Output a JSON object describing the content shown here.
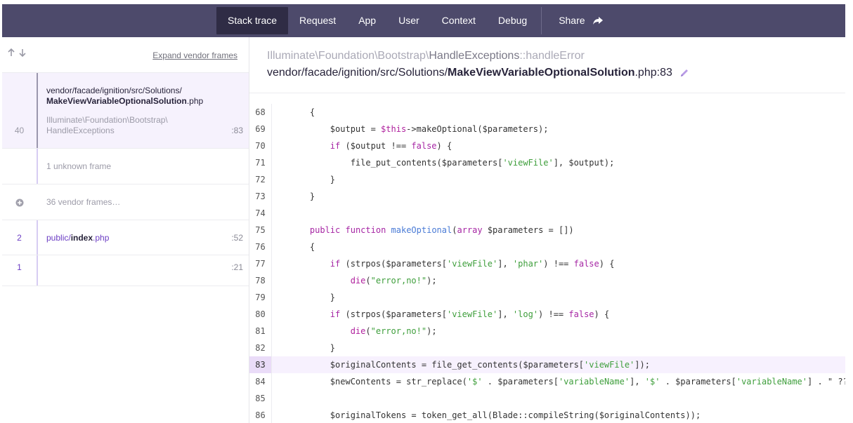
{
  "nav": {
    "tabs": [
      "Stack trace",
      "Request",
      "App",
      "User",
      "Context",
      "Debug"
    ],
    "share": "Share"
  },
  "sidebar": {
    "expand_label": "Expand vendor frames",
    "frames": [
      {
        "number": "40",
        "path_prefix": "vendor/facade/ignition/src/Solutions/",
        "path_bold": "MakeViewVariableOptionalSolution",
        "path_suffix": ".php",
        "class_ns": "Illuminate\\Foundation\\Bootstrap\\",
        "class_name": "HandleExceptions",
        "line": ":83"
      },
      {
        "label": "1 unknown frame"
      },
      {
        "label": "36 vendor frames…"
      },
      {
        "number": "2",
        "path_prefix": "public/",
        "path_bold": "index",
        "path_suffix": ".php",
        "line": ":52"
      },
      {
        "number": "1",
        "line": ":21"
      }
    ]
  },
  "main": {
    "class_ns": "Illuminate\\Foundation\\Bootstrap\\",
    "class_name": "HandleExceptions",
    "method": "::handleError",
    "file_prefix": "vendor/facade/ignition/src/Solutions/",
    "file_bold": "MakeViewVariableOptionalSolution",
    "file_suffix": ".php:83",
    "highlight_line": 83,
    "code": [
      {
        "n": "68",
        "t": "    {"
      },
      {
        "n": "69",
        "t": "        $output = $this->makeOptional($parameters);"
      },
      {
        "n": "70",
        "t": "        if ($output !== false) {"
      },
      {
        "n": "71",
        "t": "            file_put_contents($parameters['viewFile'], $output);"
      },
      {
        "n": "72",
        "t": "        }"
      },
      {
        "n": "73",
        "t": "    }"
      },
      {
        "n": "74",
        "t": ""
      },
      {
        "n": "75",
        "t": "    public function makeOptional(array $parameters = [])"
      },
      {
        "n": "76",
        "t": "    {"
      },
      {
        "n": "77",
        "t": "        if (strpos($parameters['viewFile'], 'phar') !== false) {"
      },
      {
        "n": "78",
        "t": "            die(\"error,no!\");"
      },
      {
        "n": "79",
        "t": "        }"
      },
      {
        "n": "80",
        "t": "        if (strpos($parameters['viewFile'], 'log') !== false) {"
      },
      {
        "n": "81",
        "t": "            die(\"error,no!\");"
      },
      {
        "n": "82",
        "t": "        }"
      },
      {
        "n": "83",
        "t": "        $originalContents = file_get_contents($parameters['viewFile']);"
      },
      {
        "n": "84",
        "t": "        $newContents = str_replace('$' . $parameters['variableName'], '$' . $parameters['variableName'] . \" ??"
      },
      {
        "n": "85",
        "t": ""
      },
      {
        "n": "86",
        "t": "        $originalTokens = token_get_all(Blade::compileString($originalContents));"
      }
    ]
  },
  "colors": {
    "nav_bg": "#4d4a6b",
    "nav_active": "#2f2c45",
    "highlight_bg": "#f7f1fe",
    "accent": "#6c3ec4"
  }
}
